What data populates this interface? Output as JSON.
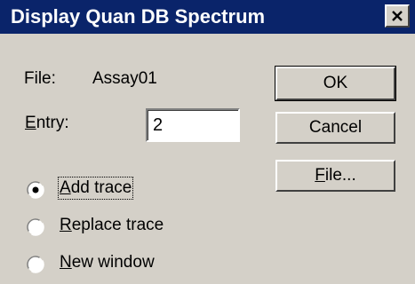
{
  "window": {
    "title": "Display Quan DB Spectrum"
  },
  "file": {
    "label": "File:",
    "value": "Assay01"
  },
  "entry": {
    "label_underlined": "E",
    "label_rest": "ntry:",
    "value": "2"
  },
  "buttons": {
    "ok": "OK",
    "cancel": "Cancel",
    "file_underlined": "F",
    "file_rest": "ile..."
  },
  "mode": {
    "selected": "add",
    "options": [
      {
        "id": "add",
        "underlined": "A",
        "rest": "dd trace"
      },
      {
        "id": "replace",
        "underlined": "R",
        "rest": "eplace trace"
      },
      {
        "id": "new",
        "underlined": "N",
        "rest": "ew window"
      }
    ]
  },
  "icons": {
    "close": "close-icon",
    "radio": "radio-icon"
  },
  "colors": {
    "titlebar": "#0a246a",
    "dialog": "#d4d0c8"
  }
}
